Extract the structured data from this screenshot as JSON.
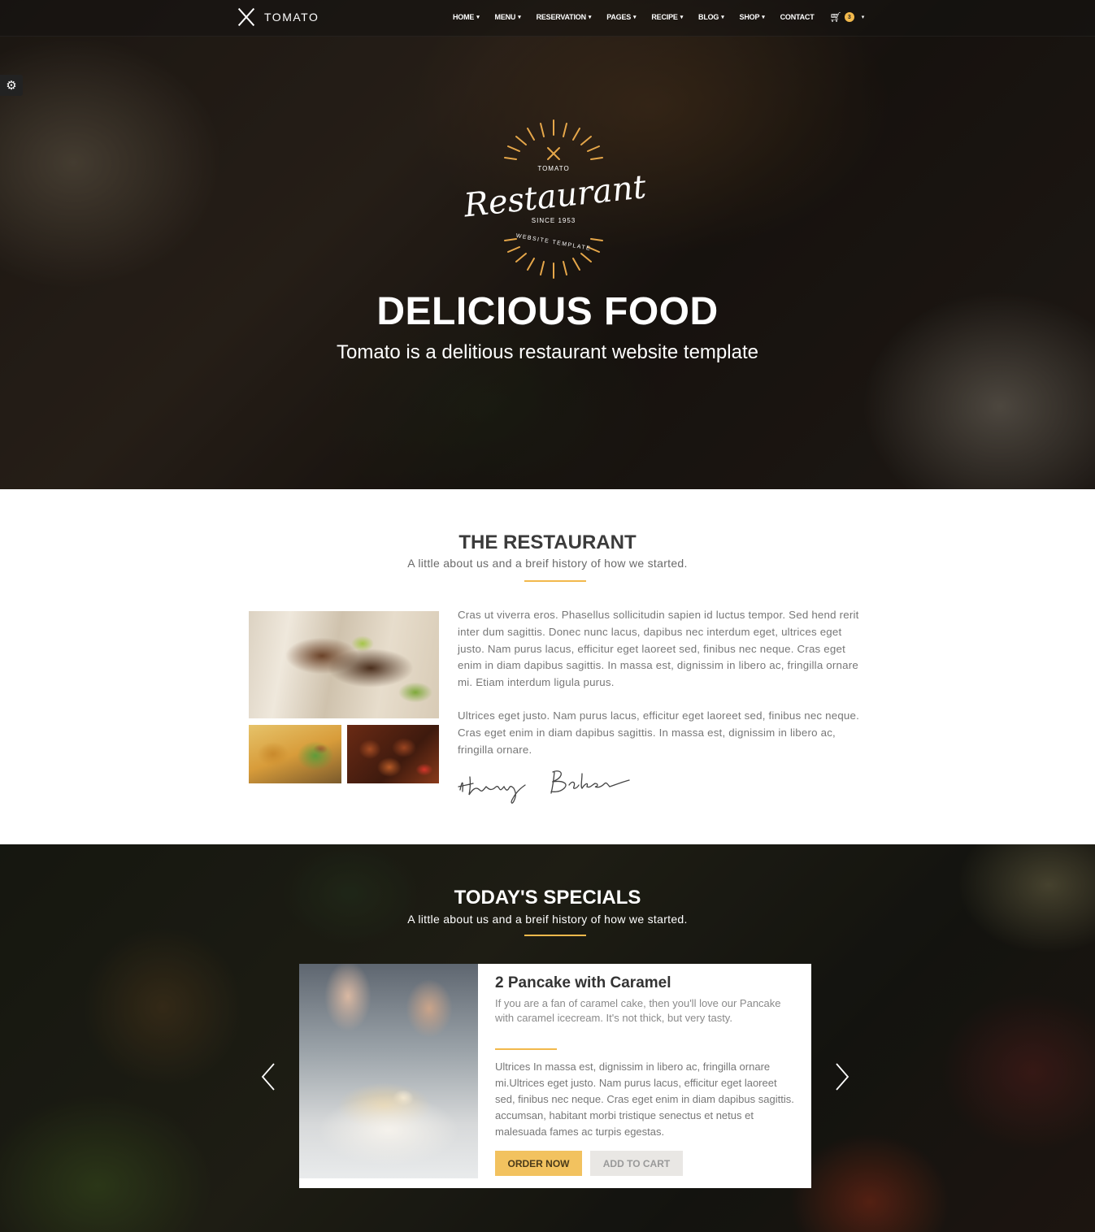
{
  "nav": {
    "brand": "TOMATO",
    "items": [
      {
        "label": "HOME",
        "has_dropdown": true
      },
      {
        "label": "MENU",
        "has_dropdown": true
      },
      {
        "label": "RESERVATION",
        "has_dropdown": true
      },
      {
        "label": "PAGES",
        "has_dropdown": true
      },
      {
        "label": "RECIPE",
        "has_dropdown": true
      },
      {
        "label": "BLOG",
        "has_dropdown": true
      },
      {
        "label": "SHOP",
        "has_dropdown": true
      },
      {
        "label": "CONTACT",
        "has_dropdown": false
      }
    ],
    "cart_count": "3",
    "cart_icon": "shopping-cart-icon"
  },
  "settings": {
    "icon": "gear-icon"
  },
  "hero": {
    "badge": {
      "top": "TOMATO",
      "script": "Restaurant",
      "since": "SINCE 1953",
      "arc": "WEBSITE TEMPLATE"
    },
    "title": "DELICIOUS FOOD",
    "subtitle": "Tomato is a delitious restaurant website template"
  },
  "restaurant": {
    "title": "THE RESTAURANT",
    "subtitle": "A little about us and a breif history of how we started.",
    "paragraph1": "Cras ut viverra eros. Phasellus sollicitudin sapien id luctus tempor. Sed hend rerit inter dum sagittis. Donec nunc lacus, dapibus nec interdum eget, ultrices eget justo. Nam purus lacus, efficitur eget laoreet sed, finibus nec neque. Cras eget enim in diam dapibus sagittis. In massa est, dignissim in libero ac, fringilla ornare mi. Etiam interdum ligula purus.",
    "paragraph2": "Ultrices eget justo. Nam purus lacus, efficitur eget laoreet sed, finibus nec neque. Cras eget enim in diam dapibus sagittis. In massa est, dignissim in libero ac, fringilla ornare.",
    "signature": "Henry Baker"
  },
  "specials": {
    "title": "TODAY'S SPECIALS",
    "subtitle": "A little about us and a breif history of how we started.",
    "item": {
      "name": "2 Pancake with Caramel",
      "intro": "If you are a fan of caramel cake, then you'll love our Pancake with caramel icecream. It's not thick, but very tasty.",
      "description": "Ultrices In massa est, dignissim in libero ac, fringilla ornare mi.Ultrices eget justo. Nam purus lacus, efficitur eget laoreet sed, finibus nec neque. Cras eget enim in diam dapibus sagittis. accumsan, habitant morbi tristique senectus et netus et malesuada fames ac turpis egestas.",
      "order_label": "ORDER NOW",
      "cart_label": "ADD TO CART"
    }
  },
  "colors": {
    "accent": "#f2b94c"
  }
}
